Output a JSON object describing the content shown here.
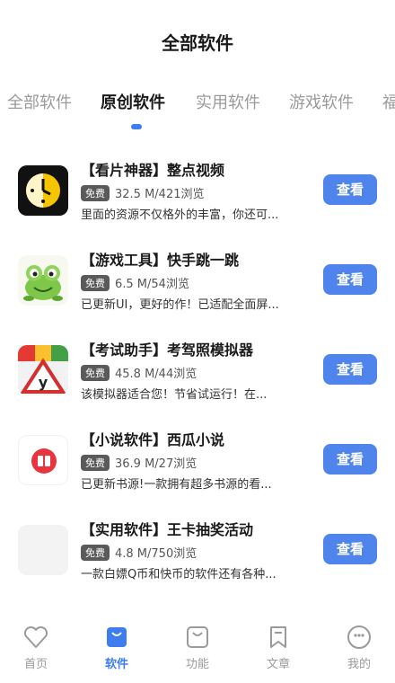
{
  "header": {
    "title": "全部软件"
  },
  "tabs": [
    {
      "label": "全部软件",
      "active": false
    },
    {
      "label": "原创软件",
      "active": true
    },
    {
      "label": "实用软件",
      "active": false
    },
    {
      "label": "游戏软件",
      "active": false
    },
    {
      "label": "福",
      "active": false
    }
  ],
  "items": [
    {
      "title": "【看片神器】整点视频",
      "badge": "免费",
      "meta": "32.5 M/421浏览",
      "desc": "里面的资源不仅格外的丰富，你还可...",
      "button": "查看",
      "icon": "clock-face-icon"
    },
    {
      "title": "【游戏工具】快手跳一跳",
      "badge": "免费",
      "meta": "6.5 M/54浏览",
      "desc": "已更新UI，更好的作！已适配全面屏...",
      "button": "查看",
      "icon": "frog-icon"
    },
    {
      "title": "【考试助手】考驾照模拟器",
      "badge": "免费",
      "meta": "45.8 M/44浏览",
      "desc": "该模拟器适合您！节省试运行！在...",
      "button": "查看",
      "icon": "traffic-sign-icon"
    },
    {
      "title": "【小说软件】西瓜小说",
      "badge": "免费",
      "meta": "36.9 M/27浏览",
      "desc": "已更新书源!一款拥有超多书源的看...",
      "button": "查看",
      "icon": "book-icon"
    },
    {
      "title": "【实用软件】王卡抽奖活动",
      "badge": "免费",
      "meta": "4.8 M/750浏览",
      "desc": "一款白嫖Q币和快币的软件还有各种...",
      "button": "查看",
      "icon": "blank-icon"
    }
  ],
  "nav": [
    {
      "label": "首页",
      "icon": "heart-icon",
      "active": false
    },
    {
      "label": "软件",
      "icon": "bag-icon",
      "active": true
    },
    {
      "label": "功能",
      "icon": "bag-outline-icon",
      "active": false
    },
    {
      "label": "文章",
      "icon": "bookmark-icon",
      "active": false
    },
    {
      "label": "我的",
      "icon": "smiley-icon",
      "active": false
    }
  ],
  "colors": {
    "accent": "#3d7df0",
    "button": "#4f84ec"
  }
}
